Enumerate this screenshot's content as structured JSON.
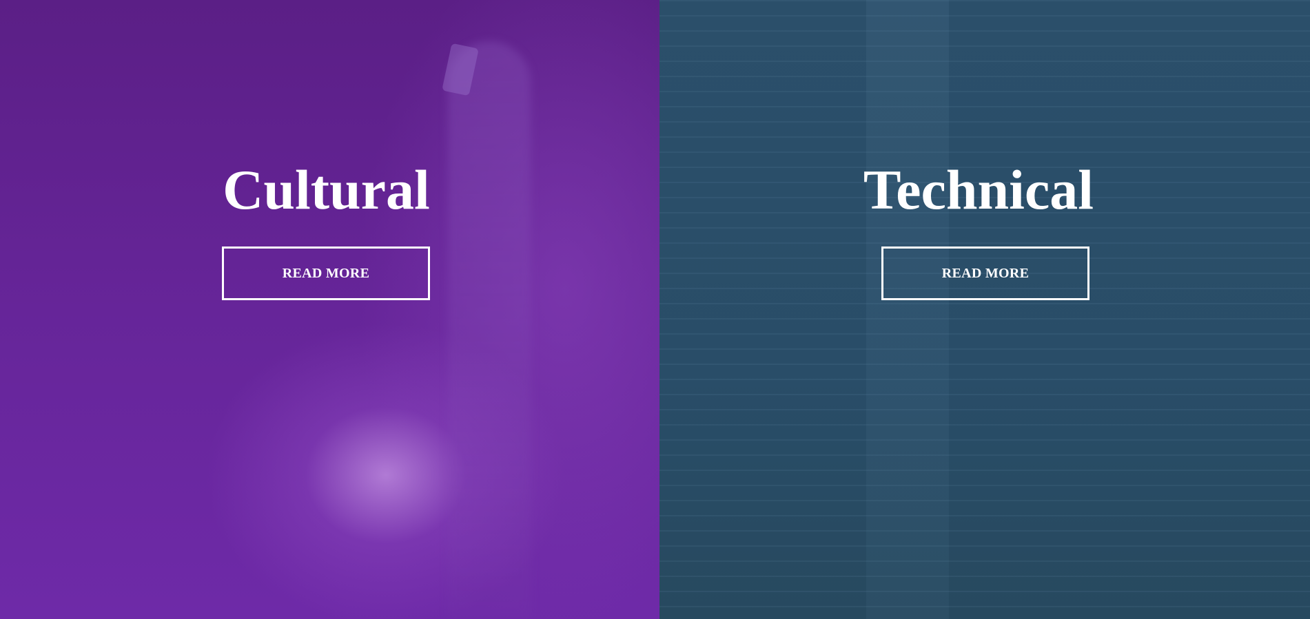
{
  "panels": [
    {
      "title": "Cultural",
      "button_label": "READ MORE",
      "background_color": "#662599"
    },
    {
      "title": "Technical",
      "button_label": "READ MORE",
      "background_color": "#294d68"
    }
  ],
  "colors": {
    "text": "#ffffff",
    "button_border": "#ffffff"
  }
}
